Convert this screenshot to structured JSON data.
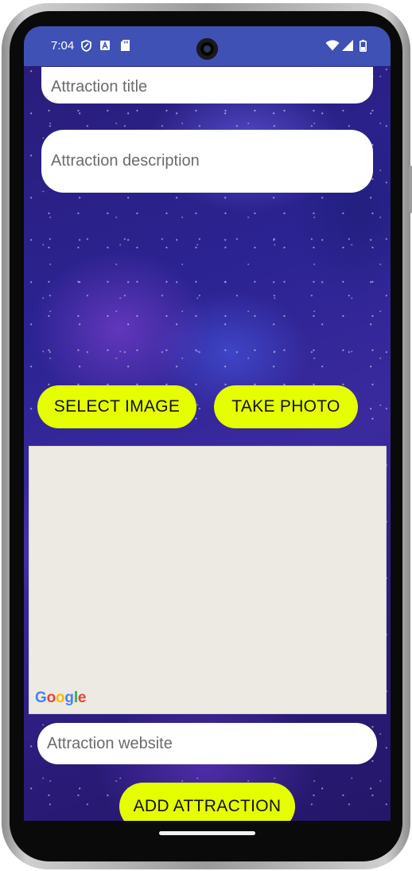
{
  "status_bar": {
    "time": "7:04",
    "background": "#3f51b5",
    "left_icons": [
      "shield-icon",
      "font-a-icon",
      "sd-card-icon"
    ],
    "right_icons": [
      "wifi-icon",
      "signal-icon",
      "battery-icon"
    ]
  },
  "form": {
    "title_placeholder": "Attraction title",
    "description_placeholder": "Attraction description",
    "website_placeholder": "Attraction website"
  },
  "buttons": {
    "select_image": "SELECT IMAGE",
    "take_photo": "TAKE PHOTO",
    "add_attraction": "ADD ATTRACTION",
    "accent_color": "#e5ff00"
  },
  "map": {
    "logo_letters": [
      "G",
      "o",
      "o",
      "g",
      "l",
      "e"
    ],
    "background": "#ede9e3"
  }
}
